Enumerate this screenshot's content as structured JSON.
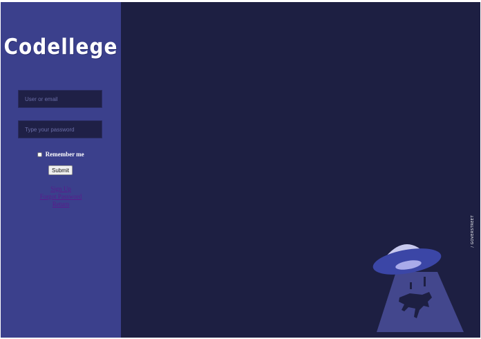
{
  "brand": {
    "logo_text": "Codellege"
  },
  "login_form": {
    "user_placeholder": "User or email",
    "password_placeholder": "Type your password",
    "remember_label": "Remember me",
    "submit_label": "Submit"
  },
  "links": {
    "signup": "Sign Up",
    "forgot_password": "Forgot Password",
    "return": "Return"
  },
  "watermark": {
    "text": "/ GOVERSTREET"
  },
  "colors": {
    "sidebar_bg": "#3b408c",
    "main_bg": "#1d1f42",
    "input_bg": "#1f2046",
    "link": "#5a1a8c",
    "ufo_light": "#4a4f9a",
    "ufo_dome": "#c8c9ee"
  },
  "illustration": {
    "name": "ufo-abducting-cow-icon"
  }
}
